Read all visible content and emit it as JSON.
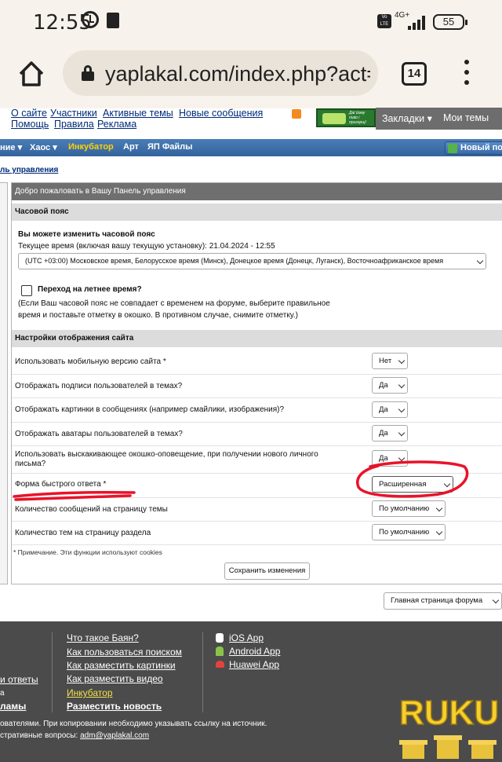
{
  "statusbar": {
    "time": "12:55",
    "network": "4G+",
    "volte": "Vo LTE",
    "battery": "55"
  },
  "browser": {
    "url": "yaplakal.com/index.php?act=",
    "tab_count": "14"
  },
  "toplinks": {
    "about": "О сайте",
    "members": "Участники",
    "active": "Активные темы",
    "new_msgs": "Новые сообщения",
    "help": "Помощь",
    "rules": "Правила",
    "ads": "Реклама"
  },
  "ad": {
    "text": "Даї йому пиво і пригорщ!"
  },
  "userbar": {
    "bookmarks": "Закладки ▾",
    "my_topics": "Мои темы"
  },
  "nav": {
    "items": [
      "ние ▾",
      "Хаос ▾",
      "Инкубатор",
      "Арт",
      "ЯП Файлы"
    ],
    "new_post": "Новый по",
    "active_color": "#ffd200"
  },
  "breadcrumb": "ль управления",
  "panel": {
    "welcome": "Добро пожаловать в Вашу Панель управления",
    "tz_section": "Часовой пояс",
    "tz_title": "Вы можете изменить часовой пояс",
    "tz_current": "Текущее время (включая вашу текущую установку): 21.04.2024 - 12:55",
    "tz_value": "(UTC +03:00) Московское время, Белорусское время (Минск), Донецкое время (Донецк, Луганск), Восточноафриканское время",
    "dst_label": "Переход на летнее время?",
    "dst_help1": "(Если Ваш часовой пояс не совпадает с временем на форуме, выберите правильное",
    "dst_help2": "время и поставьте отметку в окошко. В противном случае, снимите отметку.)",
    "display_section": "Настройки отображения сайта",
    "settings": [
      {
        "label": "Использовать мобильную версию сайта *",
        "value": "Нет"
      },
      {
        "label": "Отображать подписи пользователей в темах?",
        "value": "Да"
      },
      {
        "label": "Отображать картинки в сообщениях (например смайлики, изображения)?",
        "value": "Да"
      },
      {
        "label": "Отображать аватары пользователей в темах?",
        "value": "Да"
      },
      {
        "label": "Использовать выскакивающее окошко-оповещение, при получении нового личного",
        "label2": "письма?",
        "value": "Да"
      },
      {
        "label": "Форма быстрого ответа *",
        "value": "Расширенная"
      },
      {
        "label": "Количество сообщений на страницу темы",
        "value": "По умолчанию"
      },
      {
        "label": "Количество тем на страницу раздела",
        "value": "По умолчанию"
      }
    ],
    "note": "* Примечание. Эти функции используют cookies",
    "save": "Сохранить изменения"
  },
  "forum_select": "Главная страница форума",
  "footer": {
    "col2": [
      "Что такое Баян?",
      "Как пользоваться поиском",
      "Как разместить картинки",
      "Как разместить видео",
      "Инкубатор",
      "Разместить новость"
    ],
    "col3": [
      "iOS App",
      "Android App",
      "Huawei App"
    ],
    "col1": [
      "и ответы",
      "а",
      "ламы"
    ],
    "copyright": "ователями. При копировании необходимо указывать ссылку на источник.",
    "admin_prefix": "стративные вопросы: ",
    "admin_email": "adm@yaplakal.com",
    "logo_text": "RUKU"
  },
  "colors": {
    "annotation": "#e8132a",
    "nav": "#3b6ea8",
    "incubator": "#f2e04a"
  }
}
